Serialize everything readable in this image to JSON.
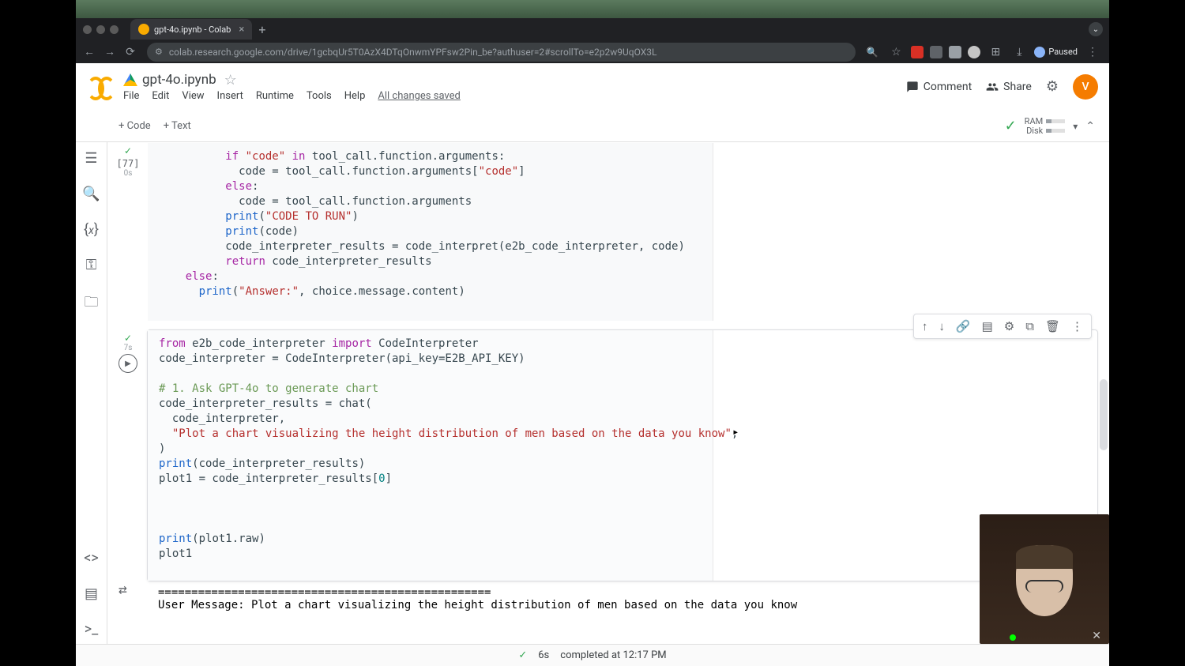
{
  "browser": {
    "tab_title": "gpt-4o.ipynb - Colab",
    "url": "colab.research.google.com/drive/1gcbqUr5T0AzX4DTqOnwmYPFsw2Pin_be?authuser=2#scrollTo=e2p2w9UqOX3L",
    "paused_label": "Paused"
  },
  "header": {
    "filename": "gpt-4o.ipynb",
    "menu": {
      "file": "File",
      "edit": "Edit",
      "view": "View",
      "insert": "Insert",
      "runtime": "Runtime",
      "tools": "Tools",
      "help": "Help"
    },
    "saved": "All changes saved",
    "comment": "Comment",
    "share": "Share",
    "avatar_letter": "V"
  },
  "toolbar": {
    "code": "+ Code",
    "text": "+ Text",
    "ram": "RAM",
    "disk": "Disk"
  },
  "cell1": {
    "exec_count": "[77]",
    "exec_time": "0s",
    "line1a": "if",
    "line1b": "\"code\"",
    "line1c": "in",
    "line1d": " tool_call.function.arguments:",
    "line2a": "code = tool_call.function.arguments[",
    "line2b": "\"code\"",
    "line2c": "]",
    "line3": "else",
    "line3b": ":",
    "line4": "code = tool_call.function.arguments",
    "line5a": "print",
    "line5b": "(",
    "line5c": "\"CODE TO RUN\"",
    "line5d": ")",
    "line6a": "print",
    "line6b": "(code)",
    "line7": "code_interpreter_results = code_interpret(e2b_code_interpreter, code)",
    "line8a": "return",
    "line8b": " code_interpreter_results",
    "line9": "else",
    "line9b": ":",
    "line10a": "print",
    "line10b": "(",
    "line10c": "\"Answer:\"",
    "line10d": ", choice.message.content)"
  },
  "cell2": {
    "exec_time": "7s",
    "l1a": "from",
    "l1b": " e2b_code_interpreter ",
    "l1c": "import",
    "l1d": " CodeInterpreter",
    "l2": "code_interpreter = CodeInterpreter(api_key=E2B_API_KEY)",
    "l4": "# 1. Ask GPT-4o to generate chart",
    "l5": "code_interpreter_results = chat(",
    "l6": "  code_interpreter,",
    "l7": "\"Plot a chart visualizing the height distribution of men based on the data you know\"",
    "l7b": ",",
    "l8": ")",
    "l9a": "print",
    "l9b": "(code_interpreter_results)",
    "l10a": "plot1 = code_interpreter_results[",
    "l10b": "0",
    "l10c": "]",
    "l13a": "print",
    "l13b": "(plot1.raw)",
    "l14": "plot1"
  },
  "output": {
    "sep": "==================================================",
    "msg": "User Message: Plot a chart visualizing the height distribution of men based on the data you know"
  },
  "status": {
    "duration": "6s",
    "completed": "completed at 12:17 PM"
  }
}
